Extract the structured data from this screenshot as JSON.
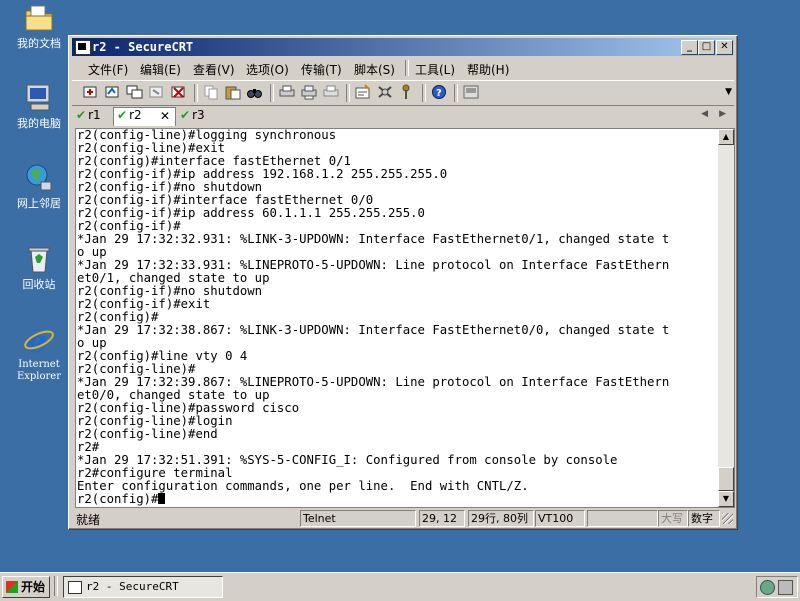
{
  "desktop": {
    "icons": [
      {
        "label": "我的文档"
      },
      {
        "label": "我的电脑"
      },
      {
        "label": "网上邻居"
      },
      {
        "label": "回收站"
      },
      {
        "label_line1": "Internet",
        "label_line2": "Explorer"
      }
    ]
  },
  "window": {
    "title": "r2 - SecureCRT",
    "minimize": "_",
    "maximize": "□",
    "close": "✕"
  },
  "menu": {
    "file": "文件(F)",
    "edit": "编辑(E)",
    "view": "查看(V)",
    "options": "选项(O)",
    "transfer": "传输(T)",
    "script": "脚本(S)",
    "tools": "工具(L)",
    "help": "帮助(H)"
  },
  "tabs": [
    {
      "label": "r1"
    },
    {
      "label": "r2",
      "close": "✕"
    },
    {
      "label": "r3"
    }
  ],
  "terminal": {
    "lines": [
      "r2(config-line)#logging synchronous",
      "r2(config-line)#exit",
      "r2(config)#interface fastEthernet 0/1",
      "r2(config-if)#ip address 192.168.1.2 255.255.255.0",
      "r2(config-if)#no shutdown",
      "r2(config-if)#interface fastEthernet 0/0",
      "r2(config-if)#ip address 60.1.1.1 255.255.255.0",
      "r2(config-if)#",
      "*Jan 29 17:32:32.931: %LINK-3-UPDOWN: Interface FastEthernet0/1, changed state t",
      "o up",
      "*Jan 29 17:32:33.931: %LINEPROTO-5-UPDOWN: Line protocol on Interface FastEthern",
      "et0/1, changed state to up",
      "r2(config-if)#no shutdown",
      "r2(config-if)#exit",
      "r2(config)#",
      "*Jan 29 17:32:38.867: %LINK-3-UPDOWN: Interface FastEthernet0/0, changed state t",
      "o up",
      "r2(config)#line vty 0 4",
      "r2(config-line)#",
      "*Jan 29 17:32:39.867: %LINEPROTO-5-UPDOWN: Line protocol on Interface FastEthern",
      "et0/0, changed state to up",
      "r2(config-line)#password cisco",
      "r2(config-line)#login",
      "r2(config-line)#end",
      "r2#",
      "*Jan 29 17:32:51.391: %SYS-5-CONFIG_I: Configured from console by console",
      "r2#configure terminal",
      "Enter configuration commands, one per line.  End with CNTL/Z.",
      "r2(config)#"
    ]
  },
  "status": {
    "ready": "就绪",
    "protocol": "Telnet",
    "position": "29, 12",
    "size": "29行, 80列",
    "terminal_type": "VT100",
    "caps": "大写",
    "num": "数字"
  },
  "taskbar": {
    "start": "开始",
    "task": "r2 - SecureCRT"
  }
}
